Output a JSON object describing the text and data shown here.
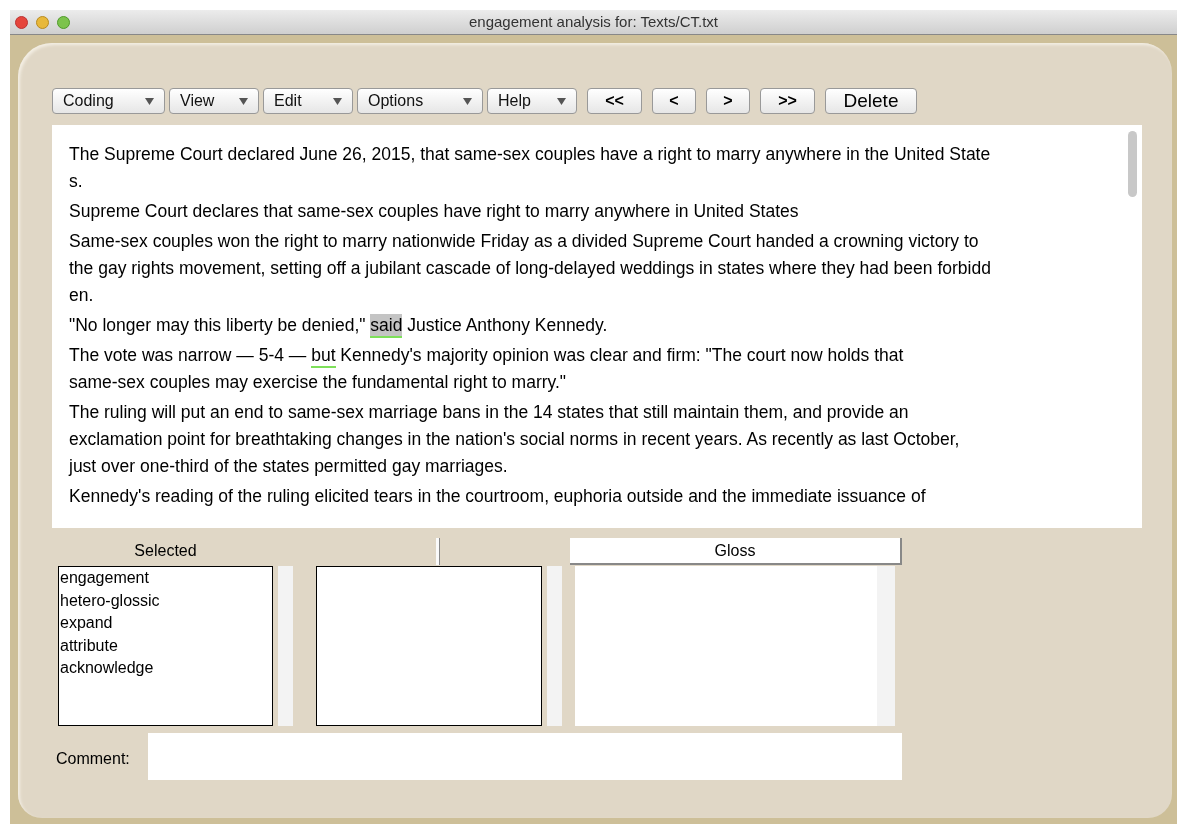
{
  "window": {
    "title": "engagement analysis for: Texts/CT.txt"
  },
  "menus": [
    {
      "label": "Coding"
    },
    {
      "label": "View"
    },
    {
      "label": "Edit"
    },
    {
      "label": "Options"
    },
    {
      "label": "Help"
    }
  ],
  "nav_buttons": [
    "<<",
    "<",
    ">",
    ">>",
    "Delete"
  ],
  "paragraphs": [
    {
      "lines": [
        [
          {
            "text": "The Supreme Court declared June 26, 2015, that same-sex couples have a right to marry anywhere in the United State"
          }
        ],
        [
          {
            "text": "s."
          }
        ]
      ]
    },
    {
      "lines": [
        [
          {
            "text": "Supreme Court declares that same-sex couples have right to marry anywhere in United States"
          }
        ]
      ]
    },
    {
      "lines": [
        [
          {
            "text": "Same-sex couples won the right to marry nationwide Friday as a divided Supreme Court handed a crowning victory to"
          }
        ],
        [
          {
            "text": "the gay rights movement, setting off a jubilant cascade of long-delayed weddings in states where they had been forbidd"
          }
        ],
        [
          {
            "text": "en."
          }
        ]
      ]
    },
    {
      "lines": [
        [
          {
            "text": "\"No longer may this liberty be denied,\" "
          },
          {
            "text": "said",
            "kind": "highlight"
          },
          {
            "text": " Justice Anthony Kennedy."
          }
        ]
      ]
    },
    {
      "lines": [
        [
          {
            "text": "The vote was narrow — 5-4 — "
          },
          {
            "text": "but",
            "kind": "underline"
          },
          {
            "text": " Kennedy's majority opinion was clear and firm: \"The court now holds that"
          }
        ],
        [
          {
            "text": "same-sex couples may exercise the fundamental right to marry.\""
          }
        ]
      ]
    },
    {
      "lines": [
        [
          {
            "text": "The ruling will put an end to same-sex marriage bans in the 14 states that still maintain them, and provide an"
          }
        ],
        [
          {
            "text": "exclamation point for breathtaking changes in the nation's social norms in recent years. As recently as last October,"
          }
        ],
        [
          {
            "text": "just over one-third of the states permitted gay marriages."
          }
        ]
      ]
    },
    {
      "lines": [
        [
          {
            "text": "Kennedy's reading of the ruling elicited tears in the courtroom, euphoria outside and the immediate issuance of"
          }
        ]
      ]
    }
  ],
  "selected_panel": {
    "heading": "Selected",
    "items": [
      "engagement",
      "hetero-glossic",
      "expand",
      "attribute",
      "acknowledge"
    ]
  },
  "gloss_panel": {
    "heading": "Gloss"
  },
  "comment": {
    "label": "Comment:"
  }
}
